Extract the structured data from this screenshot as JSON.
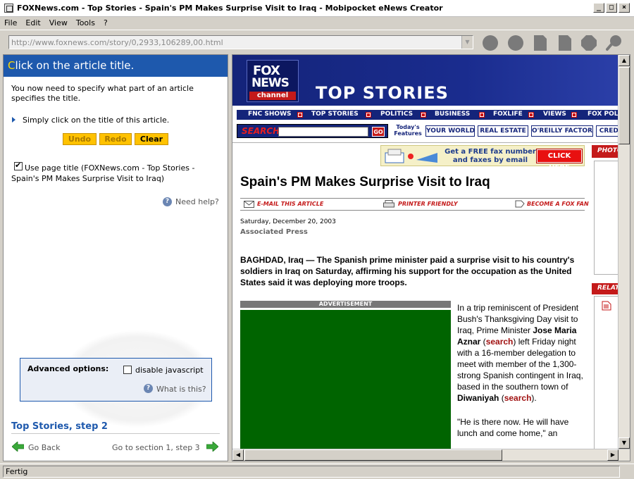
{
  "window": {
    "title": "FOXNews.com - Top Stories - Spain's PM Makes Surprise Visit to Iraq - Mobipocket eNews Creator",
    "controls": [
      "_",
      "□",
      "×"
    ]
  },
  "menu": {
    "items": [
      "File",
      "Edit",
      "View",
      "Tools",
      "?"
    ]
  },
  "toolbar": {
    "url": "http://www.foxnews.com/story/0,2933,106289,00.html",
    "buttons": [
      "circle-button-1",
      "circle-button-2",
      "page-button-1",
      "page-button-2",
      "octagon-button",
      "search-magnifier-button"
    ]
  },
  "left_panel": {
    "header_first": "C",
    "header_rest": "lick on the article title.",
    "intro": "You now need to specify what part of an article specifies the title.",
    "instruction": "Simply click on the title of this article.",
    "buttons": {
      "undo": "Undo",
      "redo": "Redo",
      "clear": "Clear"
    },
    "use_page_title": "Use page title (FOXNews.com - Top Stories - Spain's PM Makes Surprise Visit to Iraq)",
    "need_help": "Need help?",
    "advanced": {
      "label": "Advanced options:",
      "disable_js": "disable javascript",
      "what_is_this": "What is this?"
    },
    "step_title": "Top Stories, step 2",
    "go_back": "Go Back",
    "go_next": "Go to section 1, step 3"
  },
  "page": {
    "logo": {
      "line1": "FOX",
      "line2": "NEWS",
      "line3": "channel"
    },
    "banner_title": "TOP STORIES",
    "nav": [
      "FNC SHOWS",
      "TOP STORIES",
      "POLITICS",
      "BUSINESS",
      "FOXLIFE",
      "VIEWS",
      "FOX POL"
    ],
    "search_label": "SEARCH",
    "go_label": "GO",
    "todays_features": "Today's Features",
    "features": [
      "YOUR WORLD",
      "REAL ESTATE",
      "O'REILLY FACTOR",
      "CREDI"
    ],
    "fax_ad": {
      "text": "Get a FREE fax number and faxes by email",
      "cta": "CLICK HERE"
    },
    "headline": "Spain's PM Makes Surprise Visit to Iraq",
    "article_tools": [
      "E-MAIL THIS ARTICLE",
      "PRINTER FRIENDLY",
      "BECOME A FOX FAN"
    ],
    "date": "Saturday, December 20, 2003",
    "source": "Associated Press",
    "lede": "BAGHDAD, Iraq  — The Spanish prime minister paid a surprise visit to his country's soldiers in Iraq on Saturday, affirming his support for the occupation as the United States said it was deploying more troops.",
    "ad_label": "ADVERTISEMENT",
    "body1_a": "In a trip reminiscent of President Bush's Thanksgiving Day visit to Iraq, Prime Minister ",
    "body1_name": "Jose Maria Aznar",
    "body1_b": " (",
    "search_link": "search",
    "body1_c": ") left Friday night with a 16-member delegation to meet with member of the 1,300-strong Spanish contingent in Iraq, based in the southern town of ",
    "body1_town": "Diwaniyah",
    "body1_d": " (",
    "body1_e": ").",
    "body2": "\"He is there now. He will have lunch and come home,\" an",
    "photo_header": "PHOTO",
    "related_header": "RELAT"
  },
  "status": {
    "text": "Fertig"
  }
}
